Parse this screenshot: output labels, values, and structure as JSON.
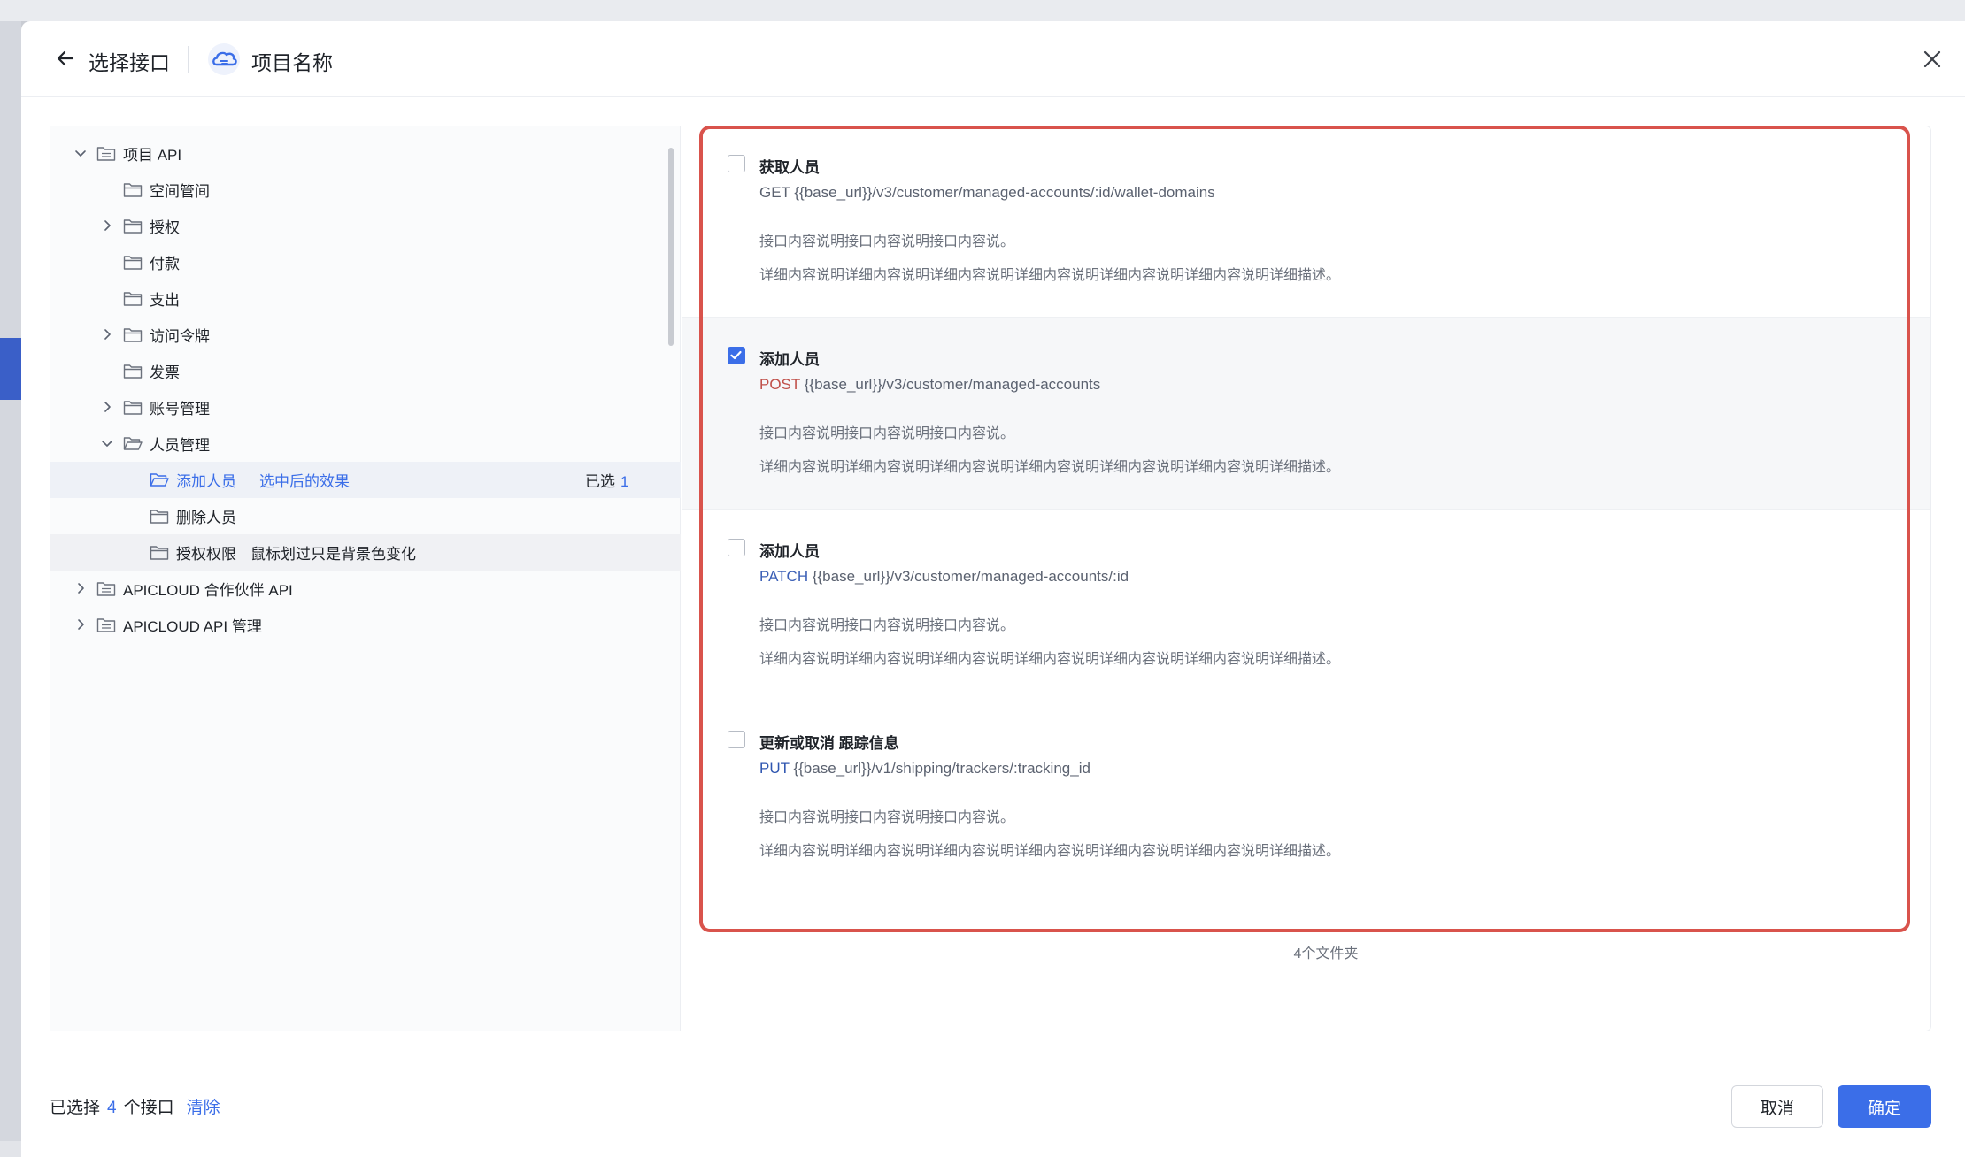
{
  "header": {
    "back_icon": "arrow-left-icon",
    "title": "选择接口",
    "project_logo": "cloud-logo-icon",
    "project_name": "项目名称",
    "close_icon": "close-icon"
  },
  "tree": {
    "items": [
      {
        "label": "项目 API",
        "level": 0,
        "chevron": "down",
        "icon": "doc-folder-icon"
      },
      {
        "label": "空间管间",
        "level": 1,
        "chevron": "none",
        "icon": "folder-icon"
      },
      {
        "label": "授权",
        "level": 1,
        "chevron": "right",
        "icon": "folder-icon"
      },
      {
        "label": "付款",
        "level": 1,
        "chevron": "none",
        "icon": "folder-icon"
      },
      {
        "label": "支出",
        "level": 1,
        "chevron": "none",
        "icon": "folder-icon"
      },
      {
        "label": "访问令牌",
        "level": 1,
        "chevron": "right",
        "icon": "folder-icon"
      },
      {
        "label": "发票",
        "level": 1,
        "chevron": "none",
        "icon": "folder-icon"
      },
      {
        "label": "账号管理",
        "level": 1,
        "chevron": "right",
        "icon": "folder-icon"
      },
      {
        "label": "人员管理",
        "level": 1,
        "chevron": "down",
        "icon": "folder-open-icon"
      },
      {
        "label": "添加人员",
        "level": 2,
        "chevron": "none",
        "icon": "folder-open-icon",
        "note": "选中后的效果",
        "selected_label": "已选",
        "selected_count": "1"
      },
      {
        "label": "删除人员",
        "level": 2,
        "chevron": "none",
        "icon": "folder-icon"
      },
      {
        "label": "授权权限",
        "level": 2,
        "chevron": "none",
        "icon": "folder-icon",
        "note": "鼠标划过只是背景色变化"
      },
      {
        "label": "APICLOUD 合作伙伴 API",
        "level": 0,
        "chevron": "right",
        "icon": "doc-folder-icon"
      },
      {
        "label": "APICLOUD API 管理",
        "level": 0,
        "chevron": "right",
        "icon": "doc-folder-icon"
      }
    ]
  },
  "apis": [
    {
      "name": "获取人员",
      "method": "GET",
      "path": "{{base_url}}/v3/customer/managed-accounts/:id/wallet-domains",
      "desc1": "接口内容说明接口内容说明接口内容说。",
      "desc2": "详细内容说明详细内容说明详细内容说明详细内容说明详细内容说明详细内容说明详细描述。",
      "checked": false
    },
    {
      "name": "添加人员",
      "method": "POST",
      "path": "{{base_url}}/v3/customer/managed-accounts",
      "desc1": "接口内容说明接口内容说明接口内容说。",
      "desc2": "详细内容说明详细内容说明详细内容说明详细内容说明详细内容说明详细内容说明详细描述。",
      "checked": true
    },
    {
      "name": "添加人员",
      "method": "PATCH",
      "path": "{{base_url}}/v3/customer/managed-accounts/:id",
      "desc1": "接口内容说明接口内容说明接口内容说。",
      "desc2": "详细内容说明详细内容说明详细内容说明详细内容说明详细内容说明详细内容说明详细描述。",
      "checked": false
    },
    {
      "name": "更新或取消 跟踪信息",
      "method": "PUT",
      "path": "{{base_url}}/v1/shipping/trackers/:tracking_id",
      "desc1": "接口内容说明接口内容说明接口内容说。",
      "desc2": "详细内容说明详细内容说明详细内容说明详细内容说明详细内容说明详细内容说明详细描述。",
      "checked": false
    }
  ],
  "folder_count": "4个文件夹",
  "footer": {
    "selected_prefix": "已选择",
    "selected_count": "4",
    "selected_suffix": "个接口",
    "clear_label": "清除",
    "cancel_label": "取消",
    "ok_label": "确定"
  },
  "colors": {
    "accent": "#3b6ee8",
    "highlight_border": "#d9534c",
    "method_post": "#c0504a"
  }
}
